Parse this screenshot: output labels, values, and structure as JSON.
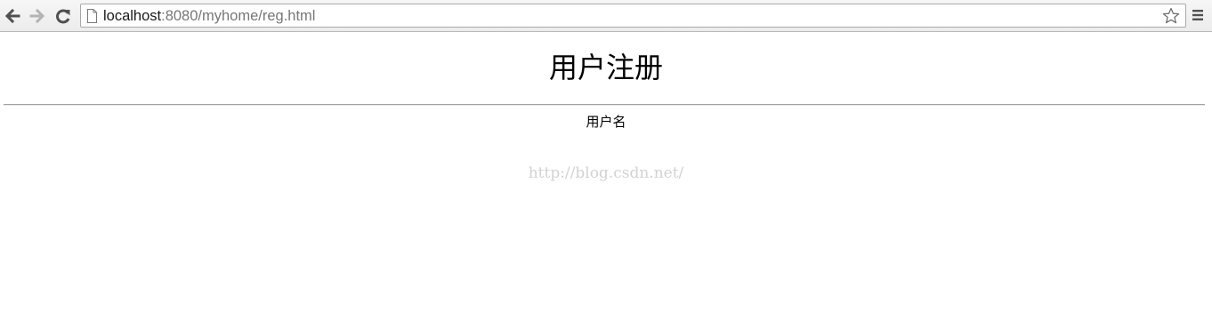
{
  "browser": {
    "url_host": "localhost",
    "url_rest": ":8080/myhome/reg.html"
  },
  "page": {
    "title": "用户注册",
    "username_label": "用户名",
    "watermark": "http://blog.csdn.net/"
  },
  "icons": {
    "back": "back-arrow-icon",
    "forward": "forward-arrow-icon",
    "reload": "reload-icon",
    "page": "page-icon",
    "star": "star-icon",
    "menu": "menu-icon"
  }
}
